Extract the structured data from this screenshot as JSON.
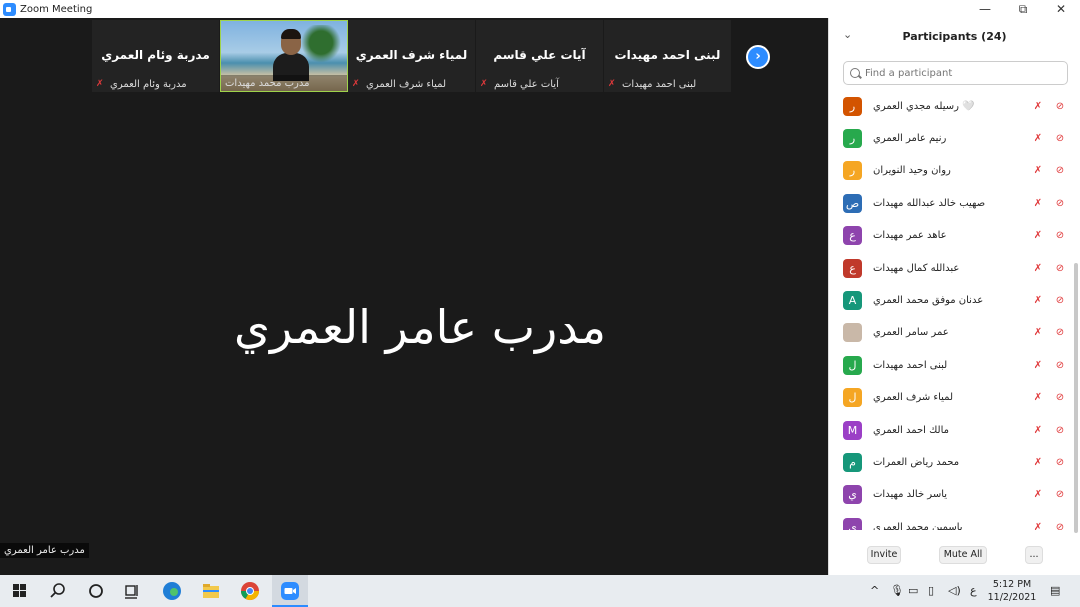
{
  "window": {
    "title": "Zoom Meeting",
    "controls": [
      "—",
      "⧉",
      "✕"
    ]
  },
  "gallery_strip": [
    {
      "big": "مدربة وئام العمري",
      "small": "مدربة وئام العمري"
    },
    {
      "big": "",
      "small": "مدرب محمد مهيدات",
      "video": true
    },
    {
      "big": "لمياء شرف العمري",
      "small": "لمياء شرف العمري"
    },
    {
      "big": "آيات علي قاسم",
      "small": "آيات علي قاسم"
    },
    {
      "big": "لبنى احمد مهيدات",
      "small": "لبنى احمد مهيدات"
    }
  ],
  "next_arrow": "›",
  "active_speaker": {
    "name": "مدرب عامر العمري",
    "label": "مدرب عامر العمري"
  },
  "participants_panel": {
    "title": "Participants (24)",
    "collapse_icon": "⌄",
    "search_placeholder": "Find a participant",
    "items": [
      {
        "name": "رسيله مجدي العمري 🤍",
        "initial": "ر",
        "color": "#d35400"
      },
      {
        "name": "رنيم عامر العمري",
        "initial": "ر",
        "color": "#27a94d"
      },
      {
        "name": "روان وحيد النويران",
        "initial": "ر",
        "color": "#f5a623"
      },
      {
        "name": "صهيب خالد عبدالله مهيدات",
        "initial": "ص",
        "color": "#2d6db5"
      },
      {
        "name": "عاهد عمر مهيدات",
        "initial": "ع",
        "color": "#8e44ad"
      },
      {
        "name": "عبدالله كمال مهيدات",
        "initial": "ع",
        "color": "#c0392b"
      },
      {
        "name": "عدنان موفق محمد العمري",
        "initial": "A",
        "color": "#16977a"
      },
      {
        "name": "عمر سامر العمري",
        "initial": "",
        "color": "#c9b8a8"
      },
      {
        "name": "لبنى احمد مهيدات",
        "initial": "ل",
        "color": "#27a94d"
      },
      {
        "name": "لمياء شرف العمري",
        "initial": "ل",
        "color": "#f5a623"
      },
      {
        "name": "مالك احمد العمري",
        "initial": "M",
        "color": "#9b3fc6"
      },
      {
        "name": "محمد رياض العمرات",
        "initial": "م",
        "color": "#16977a"
      },
      {
        "name": "ياسر خالد مهيدات",
        "initial": "ي",
        "color": "#8e44ad"
      },
      {
        "name": "ياسمين محمد العمري",
        "initial": "ي",
        "color": "#8e44ad"
      }
    ],
    "row_icons": {
      "mic": "🎤",
      "video": "📷"
    },
    "footer": {
      "invite": "Invite",
      "mute_all": "Mute All",
      "more": "..."
    }
  },
  "taskbar": {
    "lang": "ع",
    "time": "5:12 PM",
    "date": "11/2/2021"
  },
  "colors": {
    "zoom_blue": "#2d8cff",
    "muted_red": "#e0393b",
    "stage_bg": "#1a1a1a"
  }
}
